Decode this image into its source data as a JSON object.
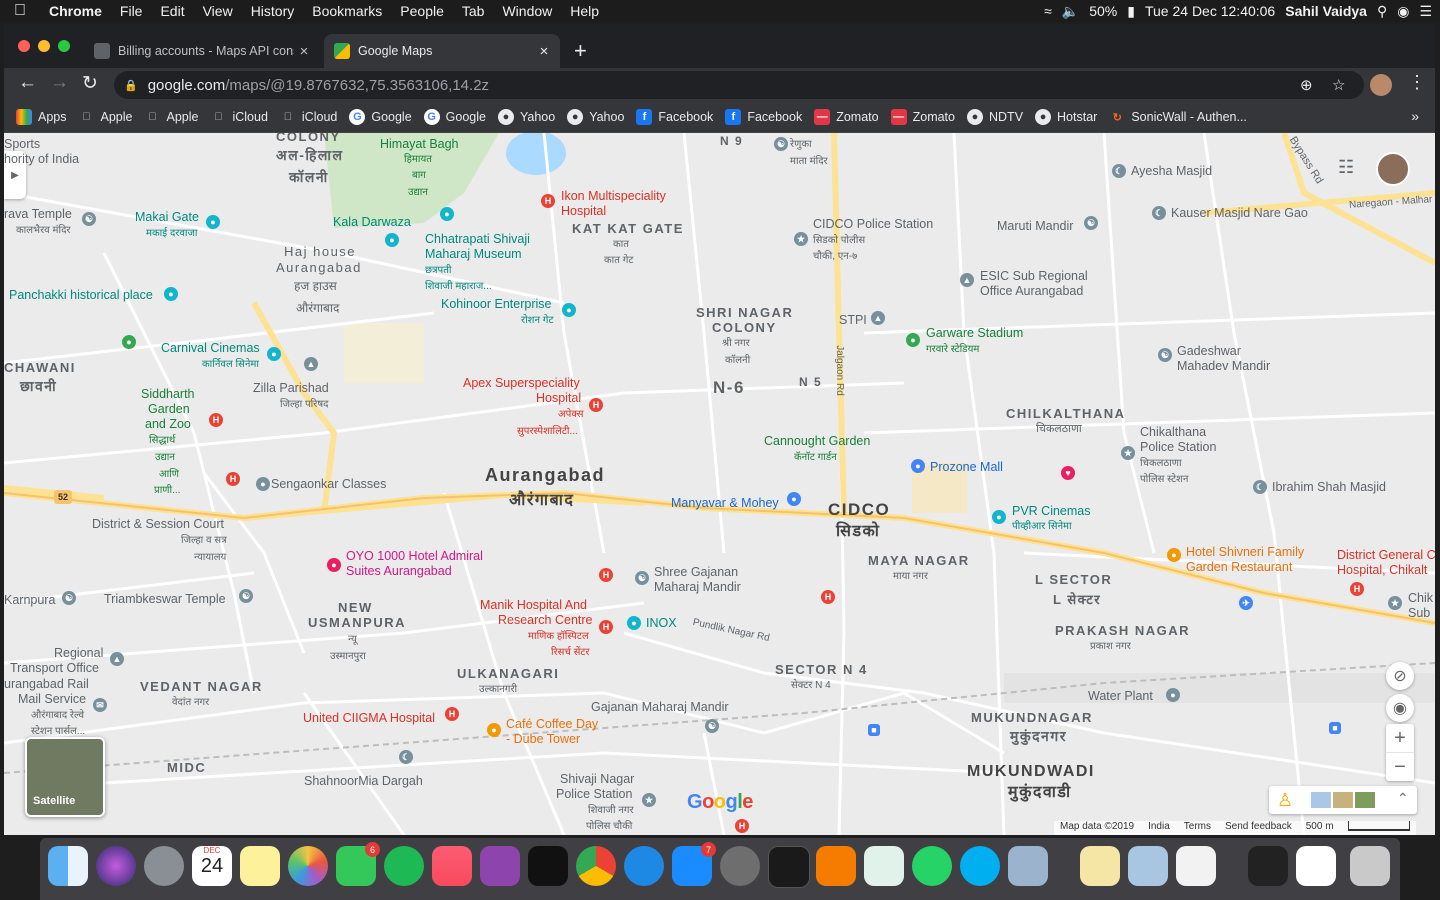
{
  "menubar": {
    "app": "Chrome",
    "items": [
      "File",
      "Edit",
      "View",
      "History",
      "Bookmarks",
      "People",
      "Tab",
      "Window",
      "Help"
    ],
    "battery": "50%",
    "datetime": "Tue 24 Dec  12:40:06",
    "user": "Sahil Vaidya"
  },
  "tabs": [
    {
      "title": "Billing accounts - Maps API cons",
      "active": false
    },
    {
      "title": "Google Maps",
      "active": true
    }
  ],
  "omnibox": {
    "host": "google.com",
    "path": "/maps/@19.8767632,75.3563106,14.2z"
  },
  "bookmarks": [
    "Apps",
    "Apple",
    "Apple",
    "iCloud",
    "iCloud",
    "Google",
    "Google",
    "Yahoo",
    "Yahoo",
    "Facebook",
    "Facebook",
    "Zomato",
    "Zomato",
    "NDTV",
    "Hotstar",
    "SonicWall - Authen..."
  ],
  "map": {
    "labels": {
      "sports": "Sports",
      "authority": "hority of India",
      "colony_top": "COLONY",
      "al_hilal": "अल-हिलाल",
      "colony_hi": "कॉलनी",
      "himayat": "Himayat Bagh",
      "himayat_hi": "हिमायत",
      "bagh_hi": "बाग",
      "udyan_hi": "उद्यान",
      "ikon": "Ikon Multispeciality",
      "ikon2": "Hospital",
      "rengua": "रेणुका",
      "rengua2": "माता मंदिर",
      "n9": "N 9",
      "ayesha": "Ayesha Masjid",
      "bypass": "Bypass Rd",
      "naregaon": "Naregaon - Malhar",
      "kauser": "Kauser Masjid Nare Gao",
      "kala_temple": "rava Temple",
      "kala_temple_hi": "कालभैरव मंदिर",
      "makai": "Makai Gate",
      "makai_hi": "मकाई दरवाजा",
      "kala_darwaza": "Kala Darwaza",
      "katkat": "KAT KAT GATE",
      "katkat_hi1": "कात",
      "katkat_hi2": "कात गेट",
      "cidco_police": "CIDCO Police Station",
      "cidco_police_hi1": "सिडको पोलीस",
      "cidco_police_hi2": "चौकी, एन-७",
      "maruti": "Maruti Mandir",
      "haj_house": "Haj house",
      "aurangabad_nb": "Aurangabad",
      "haj_hi": "हज हाउस",
      "aurangabad_hi_small": "औरंगाबाद",
      "museum": "Chhatrapati Shivaji",
      "museum2": "Maharaj Museum",
      "museum_hi1": "छत्रपती",
      "museum_hi2": "शिवाजी महाराज...",
      "esic": "ESIC Sub Regional",
      "esic2": "Office Aurangabad",
      "panchakki": "Panchakki historical place",
      "kohinoor": "Kohinoor Enterprise",
      "kohinoor_hi": "रोशन गेट",
      "shrinagar": "SHRI NAGAR",
      "shrinagar2": "COLONY",
      "shrinagar_hi1": "श्री नगर",
      "shrinagar_hi2": "कॉलनी",
      "stpi": "STPI",
      "garware": "Garware Stadium",
      "garware_hi": "गरवारे स्टेडियम",
      "carnival": "Carnival Cinemas",
      "carnival_hi": "कार्निवल सिनेमा",
      "gadeshwar": "Gadeshwar",
      "gadeshwar2": "Mahadev Mandir",
      "chawani": "CHAWANI",
      "chawani_hi": "छावनी",
      "siddharth": "Siddharth",
      "siddharth2": "Garden",
      "siddharth3": "and Zoo",
      "siddharth_hi1": "सिद्धार्थ",
      "siddharth_hi2": "उद्यान",
      "siddharth_hi3": "आणि",
      "siddharth_hi4": "प्राणी...",
      "zilla": "Zilla Parishad",
      "zilla_hi": "जिल्हा परिषद",
      "apex": "Apex Superspeciality",
      "apex2": "Hospital",
      "apex_hi1": "अपेक्स",
      "apex_hi2": "सुपरस्पेशालिटी...",
      "n6": "N-6",
      "n5": "N 5",
      "jalgaon": "Jalgaon Rd",
      "chilkalthana": "CHILKALTHANA",
      "chilkalthana_hi": "चिकलठाणा",
      "chilk_police": "Chikalthana",
      "chilk_police2": "Police Station",
      "chilk_police_hi1": "चिकलठाणा",
      "chilk_police_hi2": "पोलिस स्टेशन",
      "cannought": "Cannought Garden",
      "cannought_hi": "कॅनॉट गार्डन",
      "prozone": "Prozone Mall",
      "ibrahim": "Ibrahim Shah Masjid",
      "sengaonkar": "Sengaonkar Classes",
      "aurangabad_city": "Aurangabad",
      "aurangabad_city_hi": "औरंगाबाद",
      "manyavar": "Manyavar & Mohey",
      "cidco": "CIDCO",
      "cidco_hi": "सिडको",
      "pvr": "PVR Cinemas",
      "pvr_hi": "पीव्हीआर सिनेमा",
      "route52": "52",
      "district_court": "District & Session Court",
      "district_court_hi1": "जिल्हा व सत्र",
      "district_court_hi2": "न्यायालय",
      "oyo": "OYO 1000 Hotel Admiral",
      "oyo2": "Suites Aurangabad",
      "shree_gajanan": "Shree Gajanan",
      "shree_gajanan2": "Maharaj Mandir",
      "maya_nagar": "MAYA NAGAR",
      "maya_nagar_hi": "माया नगर",
      "shivneri": "Hotel Shivneri Family",
      "shivneri2": "Garden Restaurant",
      "district_general": "District General C",
      "district_general2": "Hospital, Chikalt",
      "karnpura": "Karnpura",
      "triambkeswar": "Triambkeswar Temple",
      "new_usmanpura": "NEW",
      "new_usmanpura2": "USMANPURA",
      "usmanpura_hi1": "न्यू",
      "usmanpura_hi2": "उस्मानपुरा",
      "manik": "Manik Hospital And",
      "manik2": "Research Centre",
      "manik_hi1": "माणिक हॉस्पिटल",
      "manik_hi2": "रिसर्च सेंटर",
      "inox": "INOX",
      "pundlik": "Pundlik Nagar Rd",
      "l_sector": "L SECTOR",
      "l_sector_hi": "L सेक्टर",
      "chik_sub": "Chik",
      "chik_sub2": "Sub",
      "regional_transport": "Regional",
      "regional_transport2": "Transport Office",
      "rail": "urangabad Rail",
      "rail2": "Mail Service",
      "rail_hi1": "औरंगाबाद रेल्वे",
      "rail_hi2": "स्टेशन पार्सल...",
      "prakash": "PRAKASH NAGAR",
      "prakash_hi": "प्रकाश नगर",
      "vedant": "VEDANT NAGAR",
      "vedant_hi": "वेदांत नगर",
      "ulkanagari": "ULKANAGARI",
      "ulkanagari_hi": "उल्कानगरी",
      "sector_n4": "SECTOR N 4",
      "sector_n4_hi": "सेक्टर N 4",
      "water_plant": "Water Plant",
      "united": "United CIIGMA Hospital",
      "gajanan_mandir": "Gajanan Maharaj Mandir",
      "cafe": "Café Coffee Day",
      "cafe2": "- Dube Tower",
      "mukund": "MUKUNDNAGAR",
      "mukund_hi": "मुकुंदनगर",
      "midc": "MIDC",
      "shahnoor": "ShahnoorMia Dargah",
      "shivaji_police": "Shivaji Nagar",
      "shivaji_police2": "Police Station",
      "shivaji_police_hi1": "शिवाजी नगर",
      "shivaji_police_hi2": "पोलिस चौकी",
      "mukundwadi": "MUKUNDWADI",
      "mukundwadi_hi": "मुकुंदवाडी"
    },
    "satellite_label": "Satellite",
    "google_logo": "Google",
    "attribution": [
      "Map data ©2019",
      "India",
      "Terms",
      "Send feedback",
      "500 m"
    ]
  },
  "dock": {
    "calendar_month": "DEC",
    "calendar_day": "24",
    "facetime_badge": "6",
    "appstore_badge": "7"
  }
}
